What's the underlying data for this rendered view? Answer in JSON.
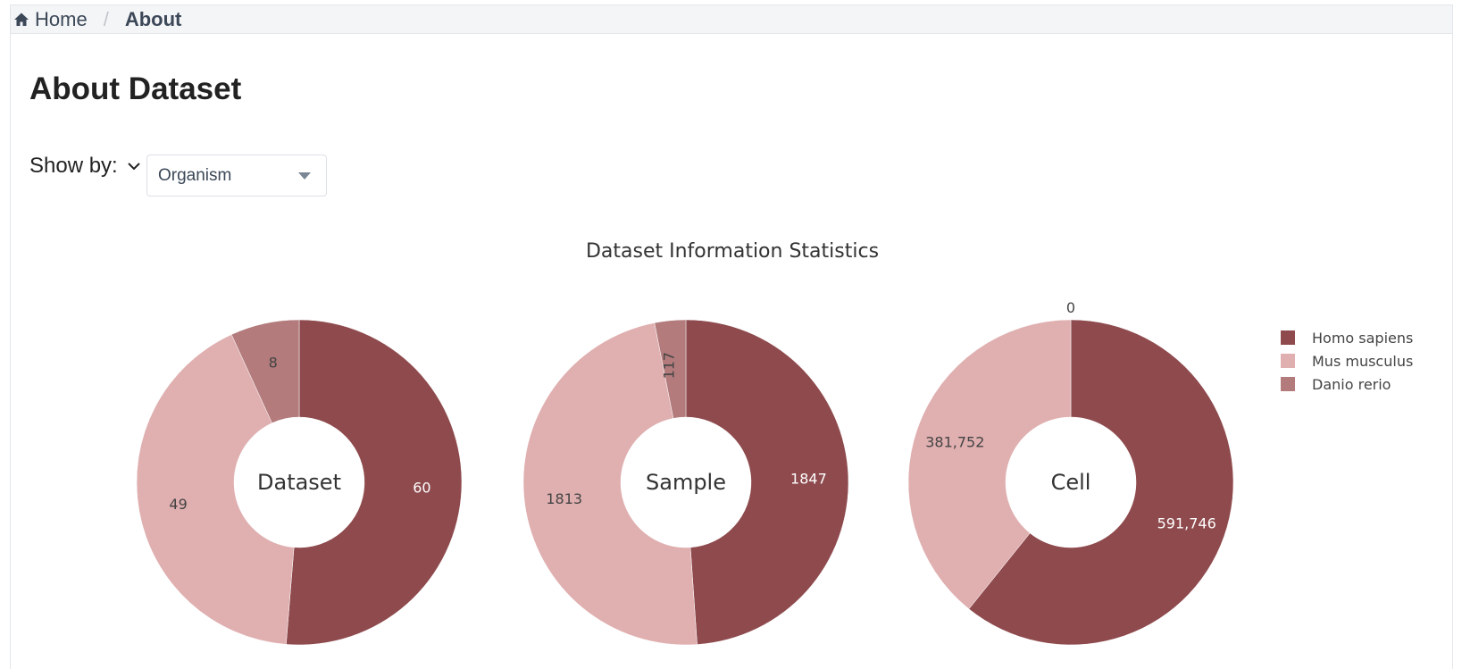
{
  "breadcrumb": {
    "home": "Home",
    "separator": "/",
    "current": "About"
  },
  "page": {
    "title": "About Dataset"
  },
  "filter": {
    "label": "Show by:",
    "selected": "Organism"
  },
  "colors": {
    "homo": "#8e4a4d",
    "mus": "#e0afb0",
    "danio": "#b37b7c",
    "text_light": "#ffffff",
    "text_dark": "#444444"
  },
  "chart_data": {
    "type": "pie",
    "title": "Dataset Information Statistics",
    "legend_position": "right",
    "categories": [
      "Homo sapiens",
      "Mus musculus",
      "Danio rerio"
    ],
    "charts": [
      {
        "name": "Dataset",
        "labels": [
          "60",
          "49",
          "8"
        ],
        "values": [
          60,
          49,
          8
        ]
      },
      {
        "name": "Sample",
        "labels": [
          "1847",
          "1813",
          "117"
        ],
        "values": [
          1847,
          1813,
          117
        ]
      },
      {
        "name": "Cell",
        "labels": [
          "591,746",
          "381,752",
          "0"
        ],
        "values": [
          591746,
          381752,
          0
        ]
      }
    ]
  }
}
